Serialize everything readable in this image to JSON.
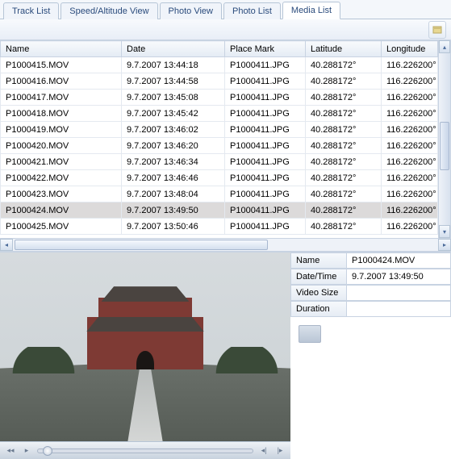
{
  "tabs": [
    {
      "label": "Track List",
      "active": false
    },
    {
      "label": "Speed/Altitude View",
      "active": false
    },
    {
      "label": "Photo View",
      "active": false
    },
    {
      "label": "Photo List",
      "active": false
    },
    {
      "label": "Media List",
      "active": true
    }
  ],
  "columns": [
    "Name",
    "Date",
    "Place Mark",
    "Latitude",
    "Longitude"
  ],
  "rows": [
    {
      "name": "P1000415.MOV",
      "date": "9.7.2007 13:44:18",
      "place": "P1000411.JPG",
      "lat": "40.288172°",
      "lon": "116.226200°",
      "sel": false
    },
    {
      "name": "P1000416.MOV",
      "date": "9.7.2007 13:44:58",
      "place": "P1000411.JPG",
      "lat": "40.288172°",
      "lon": "116.226200°",
      "sel": false
    },
    {
      "name": "P1000417.MOV",
      "date": "9.7.2007 13:45:08",
      "place": "P1000411.JPG",
      "lat": "40.288172°",
      "lon": "116.226200°",
      "sel": false
    },
    {
      "name": "P1000418.MOV",
      "date": "9.7.2007 13:45:42",
      "place": "P1000411.JPG",
      "lat": "40.288172°",
      "lon": "116.226200°",
      "sel": false
    },
    {
      "name": "P1000419.MOV",
      "date": "9.7.2007 13:46:02",
      "place": "P1000411.JPG",
      "lat": "40.288172°",
      "lon": "116.226200°",
      "sel": false
    },
    {
      "name": "P1000420.MOV",
      "date": "9.7.2007 13:46:20",
      "place": "P1000411.JPG",
      "lat": "40.288172°",
      "lon": "116.226200°",
      "sel": false
    },
    {
      "name": "P1000421.MOV",
      "date": "9.7.2007 13:46:34",
      "place": "P1000411.JPG",
      "lat": "40.288172°",
      "lon": "116.226200°",
      "sel": false
    },
    {
      "name": "P1000422.MOV",
      "date": "9.7.2007 13:46:46",
      "place": "P1000411.JPG",
      "lat": "40.288172°",
      "lon": "116.226200°",
      "sel": false
    },
    {
      "name": "P1000423.MOV",
      "date": "9.7.2007 13:48:04",
      "place": "P1000411.JPG",
      "lat": "40.288172°",
      "lon": "116.226200°",
      "sel": false
    },
    {
      "name": "P1000424.MOV",
      "date": "9.7.2007 13:49:50",
      "place": "P1000411.JPG",
      "lat": "40.288172°",
      "lon": "116.226200°",
      "sel": true
    },
    {
      "name": "P1000425.MOV",
      "date": "9.7.2007 13:50:46",
      "place": "P1000411.JPG",
      "lat": "40.288172°",
      "lon": "116.226200°",
      "sel": false
    }
  ],
  "details": {
    "labels": {
      "name": "Name",
      "date": "Date/Time",
      "size": "Video Size",
      "duration": "Duration"
    },
    "values": {
      "name": "P1000424.MOV",
      "date": "9.7.2007 13:49:50",
      "size": "",
      "duration": ""
    }
  }
}
